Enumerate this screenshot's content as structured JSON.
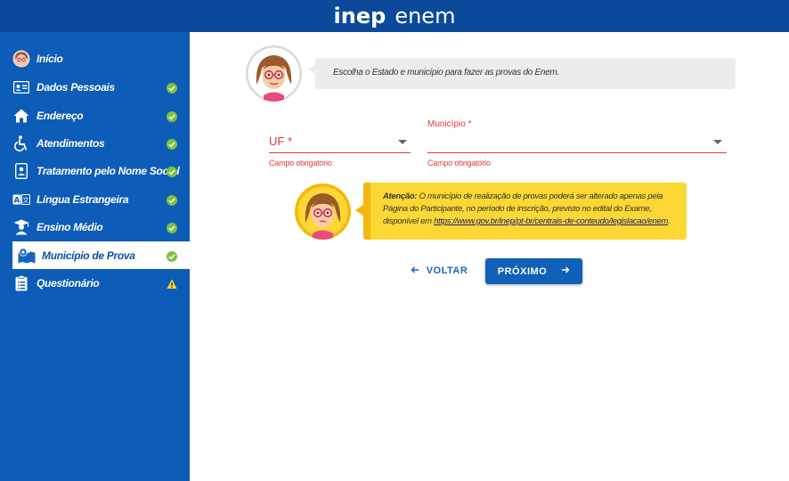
{
  "header": {
    "logo_inep": "inep",
    "logo_enem": "enem"
  },
  "sidebar": {
    "items": [
      {
        "label": "Início",
        "icon": "avatar-icon",
        "status": ""
      },
      {
        "label": "Dados Pessoais",
        "icon": "id-card-icon",
        "status": "complete"
      },
      {
        "label": "Endereço",
        "icon": "home-icon",
        "status": "complete"
      },
      {
        "label": "Atendimentos",
        "icon": "accessibility-icon",
        "status": "complete"
      },
      {
        "label": "Tratamento pelo Nome Social",
        "icon": "badge-icon",
        "status": "complete"
      },
      {
        "label": "Língua Estrangeira",
        "icon": "translate-icon",
        "status": "complete"
      },
      {
        "label": "Ensino Médio",
        "icon": "graduate-icon",
        "status": "complete"
      },
      {
        "label": "Município de Prova",
        "icon": "map-icon",
        "status": "complete"
      },
      {
        "label": "Questionário",
        "icon": "clipboard-icon",
        "status": "warning"
      }
    ],
    "active_index": 7
  },
  "instruction": {
    "text": "Escolha o Estado e município para fazer as provas do Enem."
  },
  "form": {
    "uf_label": "UF *",
    "uf_error": "Campo obrigatório",
    "municipio_label": "Município *",
    "municipio_error": "Campo obrigatório"
  },
  "attention": {
    "title": "Atenção:",
    "text": " O município de realização de provas poderá ser alterado apenas pela Página do Participante, no período de inscrição, previsto no edital do Exame, disponível em ",
    "link": "https://www.gov.br/inep/pt-br/centrais-de-conteudo/legislacao/enem",
    "end": "."
  },
  "actions": {
    "back_label": "VOLTAR",
    "next_label": "PRÓXIMO"
  },
  "colors": {
    "header_bg": "#0b4a9a",
    "sidebar_bg": "#0d5cb8",
    "error_red": "#e53935",
    "check_green": "#7cc242",
    "warning_yellow": "#fdd835",
    "primary_button": "#1060b8"
  }
}
